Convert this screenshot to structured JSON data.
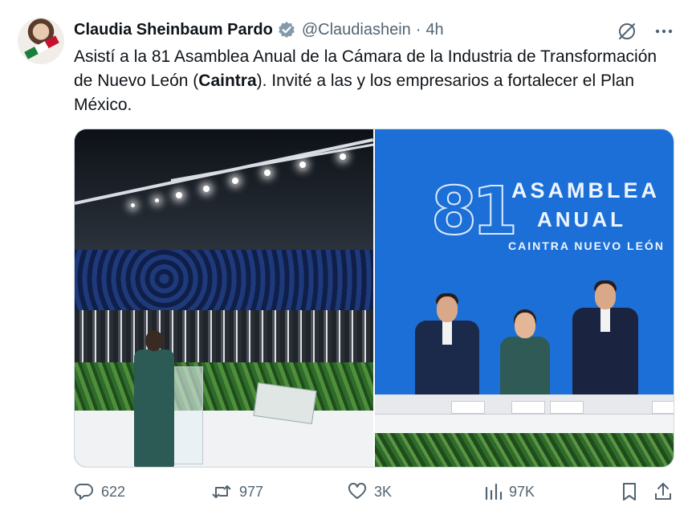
{
  "post": {
    "author_name": "Claudia Sheinbaum Pardo",
    "handle": "@Claudiashein",
    "separator": "·",
    "time": "4h",
    "text_part1": "Asistí a la 81 Asamblea Anual de la Cámara de la Industria de Transformación de Nuevo León (",
    "text_bold": "Caintra",
    "text_part2": "). Invité a las y los empresarios a fortalecer el Plan México."
  },
  "media": {
    "logo_number": "81",
    "logo_line1": "ASAMBLEA",
    "logo_line2": "ANUAL",
    "logo_line3": "CAINTRA NUEVO LEÓN"
  },
  "stats": {
    "replies": "622",
    "reposts": "977",
    "likes": "3K",
    "views": "97K"
  },
  "icons": {
    "verified": "verified-badge-icon",
    "grok": "slash-circle-icon",
    "more": "more-dots-icon",
    "reply": "reply-icon",
    "repost": "repost-icon",
    "like": "heart-icon",
    "views": "views-icon",
    "bookmark": "bookmark-icon",
    "share": "share-icon"
  },
  "colors": {
    "text": "#0f1419",
    "secondary": "#536471",
    "border": "#cfd9de",
    "verified_badge": "#829aab"
  }
}
